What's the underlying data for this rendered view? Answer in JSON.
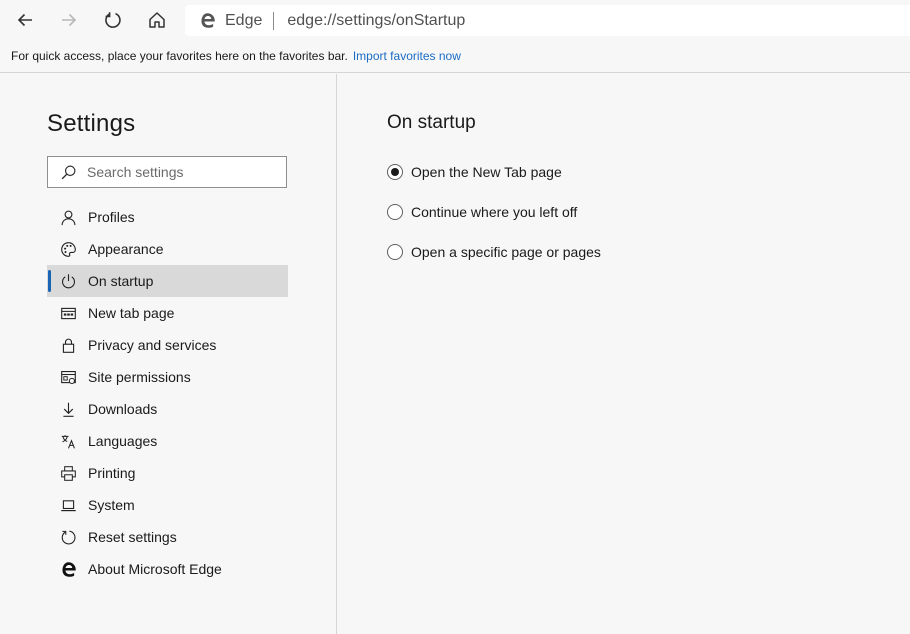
{
  "browser": {
    "address_label": "Edge",
    "url": "edge://settings/onStartup"
  },
  "favorites_bar": {
    "message": "For quick access, place your favorites here on the favorites bar.",
    "link": "Import favorites now"
  },
  "sidebar": {
    "title": "Settings",
    "search_placeholder": "Search settings",
    "items": [
      {
        "label": "Profiles",
        "icon": "person-icon"
      },
      {
        "label": "Appearance",
        "icon": "palette-icon"
      },
      {
        "label": "On startup",
        "icon": "power-icon",
        "active": true
      },
      {
        "label": "New tab page",
        "icon": "new-tab-icon"
      },
      {
        "label": "Privacy and services",
        "icon": "lock-icon"
      },
      {
        "label": "Site permissions",
        "icon": "site-permissions-icon"
      },
      {
        "label": "Downloads",
        "icon": "download-icon"
      },
      {
        "label": "Languages",
        "icon": "languages-icon"
      },
      {
        "label": "Printing",
        "icon": "printer-icon"
      },
      {
        "label": "System",
        "icon": "laptop-icon"
      },
      {
        "label": "Reset settings",
        "icon": "reset-icon"
      },
      {
        "label": "About Microsoft Edge",
        "icon": "edge-logo-icon"
      }
    ]
  },
  "main": {
    "title": "On startup",
    "options": [
      {
        "label": "Open the New Tab page",
        "selected": true
      },
      {
        "label": "Continue where you left off",
        "selected": false
      },
      {
        "label": "Open a specific page or pages",
        "selected": false
      }
    ]
  },
  "colors": {
    "accent": "#1a64b4",
    "link": "#1a6cc4",
    "selected_item_bg": "#d9d9d9"
  }
}
